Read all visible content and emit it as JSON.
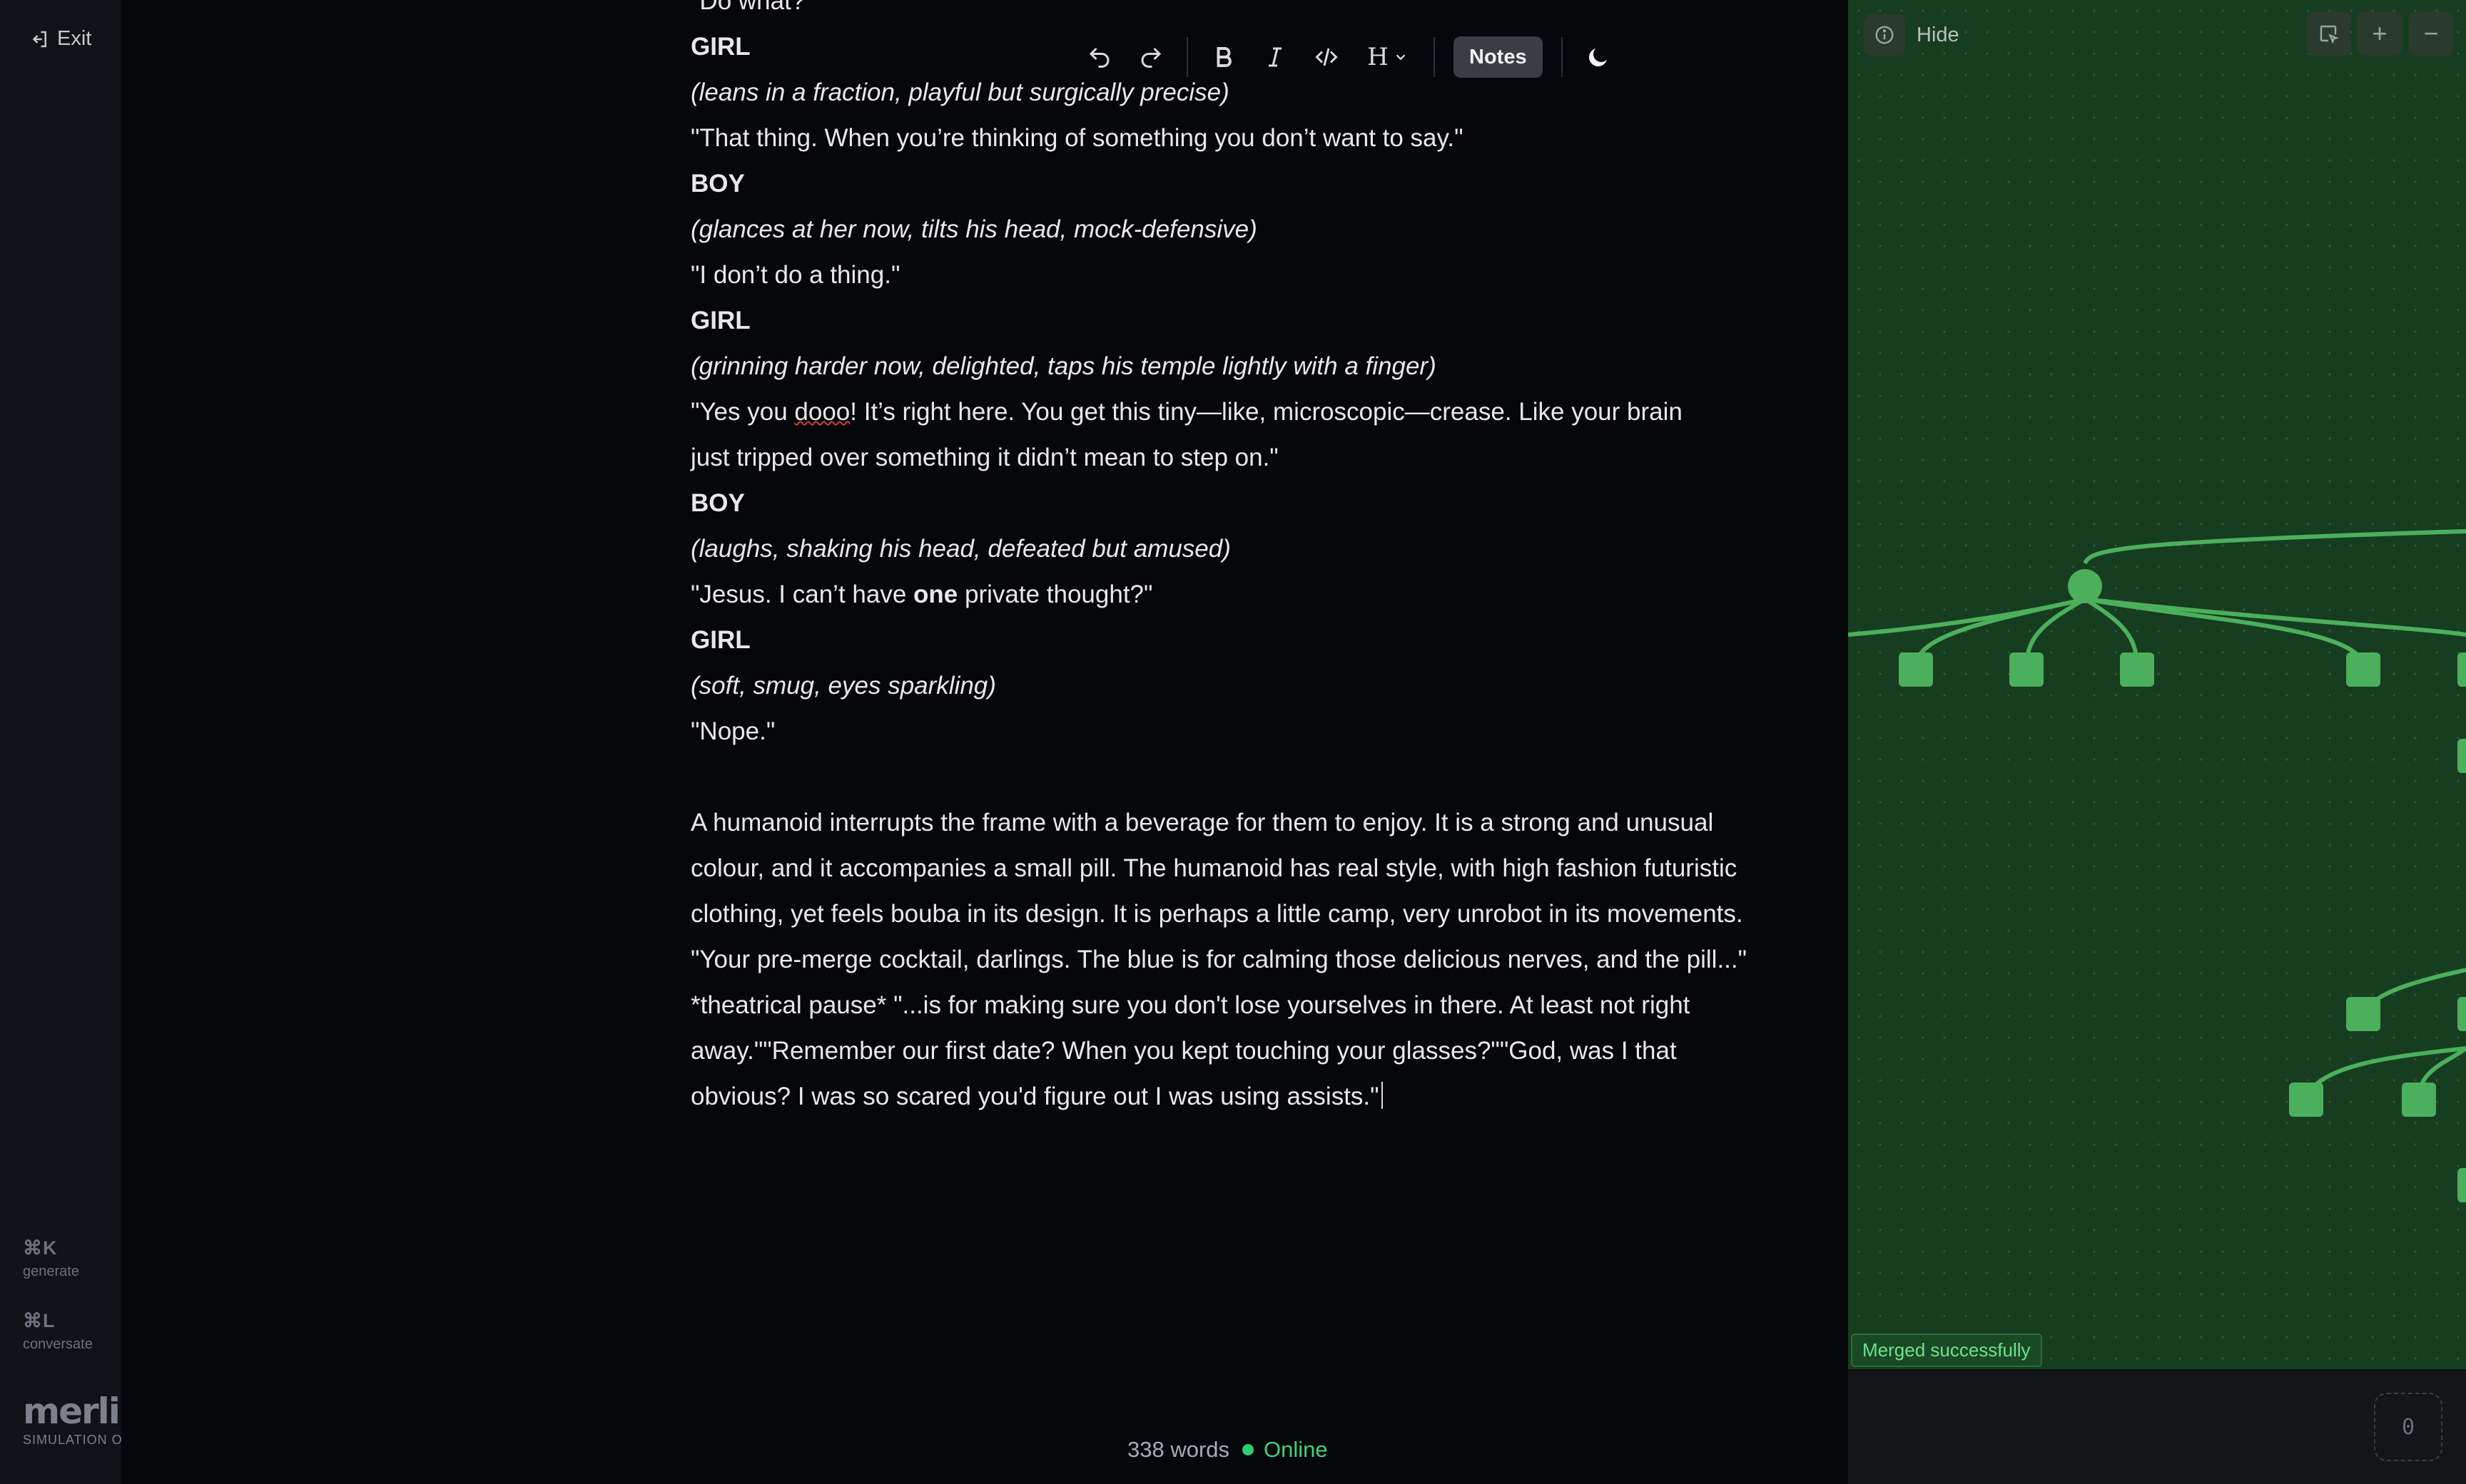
{
  "sidebar": {
    "exit_label": "Exit",
    "shortcuts": [
      {
        "key": "⌘K",
        "label": "generate"
      },
      {
        "key": "⌘L",
        "label": "conversate"
      }
    ],
    "logo": {
      "name": "merlin",
      "subtitle": "SIMULATION OS"
    }
  },
  "toolbar": {
    "heading_label": "H",
    "notes_label": "Notes"
  },
  "document": {
    "lines": [
      {
        "type": "dialogue",
        "text": "\"Do what?\""
      },
      {
        "type": "name",
        "text": "GIRL"
      },
      {
        "type": "dir",
        "text": "(leans in a fraction, playful but surgically precise)"
      },
      {
        "type": "dialogue",
        "text": "\"That thing. When you’re thinking of something you don’t want to say.\""
      },
      {
        "type": "name",
        "text": "BOY"
      },
      {
        "type": "dir",
        "text": "(glances at her now, tilts his head, mock-defensive)"
      },
      {
        "type": "dialogue",
        "text": "\"I don’t do a thing.\""
      },
      {
        "type": "name",
        "text": "GIRL"
      },
      {
        "type": "dir",
        "text": "(grinning harder now, delighted, taps his temple lightly with a finger)"
      }
    ],
    "yes_line": {
      "pre": "\"Yes you ",
      "misspelled": "dooo",
      "post1": "! It’s right here. You get this tiny—like, microscopic—crease. Like your brain",
      "post2": "just tripped over something it didn’t mean to step on.\""
    },
    "lines2": [
      {
        "type": "name",
        "text": "BOY"
      },
      {
        "type": "dir",
        "text": "(laughs, shaking his head, defeated but amused)"
      }
    ],
    "jesus_line": {
      "pre": "\"Jesus. I can’t have ",
      "bold": "one",
      "post": " private thought?\""
    },
    "lines3": [
      {
        "type": "name",
        "text": "GIRL"
      },
      {
        "type": "dir",
        "text": "(soft, smug, eyes sparkling)"
      },
      {
        "type": "dialogue",
        "text": "\"Nope.\""
      }
    ],
    "paragraph": "A humanoid interrupts the frame with a beverage for them to enjoy. It is a strong and unusual colour, and it accompanies a small pill. The humanoid has real style, with high fashion futuristic clothing, yet feels bouba in its design. It is perhaps a little camp, very unrobot in its movements. \"Your pre-merge cocktail, darlings. The blue is for calming those delicious nerves, and the pill...\" *theatrical pause* \"...is for making sure you don't lose yourselves in there. At least not right away.\"\"Remember our first date? When you kept touching your glasses?\"\"God, was I that obvious? I was so scared you'd figure out I was using assists.\""
  },
  "status": {
    "word_count": "338 words",
    "connection": "Online"
  },
  "panel": {
    "hide_label": "Hide",
    "toast": "Merged successfully",
    "counter": "0"
  },
  "colors": {
    "panel_bg": "#173d21",
    "node": "#4caf5c",
    "online": "#3fd27a"
  }
}
